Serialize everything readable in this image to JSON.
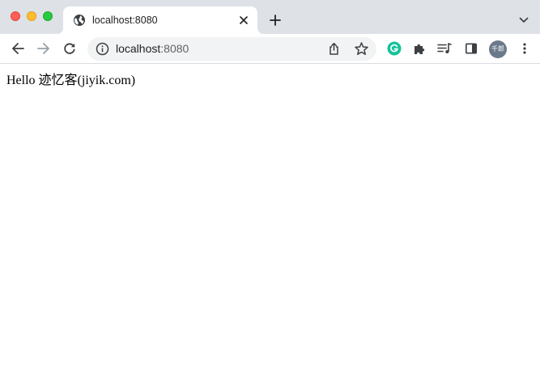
{
  "tab": {
    "title": "localhost:8080"
  },
  "address_bar": {
    "host": "localhost",
    "port": ":8080"
  },
  "profile": {
    "avatar_text": "千郎"
  },
  "page": {
    "text": "Hello 迹忆客(jiyik.com)"
  },
  "colors": {
    "tab_strip": "#dee1e6",
    "omnibox": "#f1f3f4",
    "grammarly": "#15c39a",
    "avatar": "#6b7a8a",
    "close_dot": "#ff5f57",
    "minimize_dot": "#febc2e",
    "zoom_dot": "#28c840"
  },
  "icons": [
    "globe-icon",
    "close-icon",
    "plus-icon",
    "chevron-down-icon",
    "back-arrow-icon",
    "forward-arrow-icon",
    "reload-icon",
    "info-icon",
    "share-icon",
    "star-icon",
    "grammarly-icon",
    "puzzle-icon",
    "media-queue-icon",
    "side-panel-icon",
    "kebab-menu-icon"
  ]
}
